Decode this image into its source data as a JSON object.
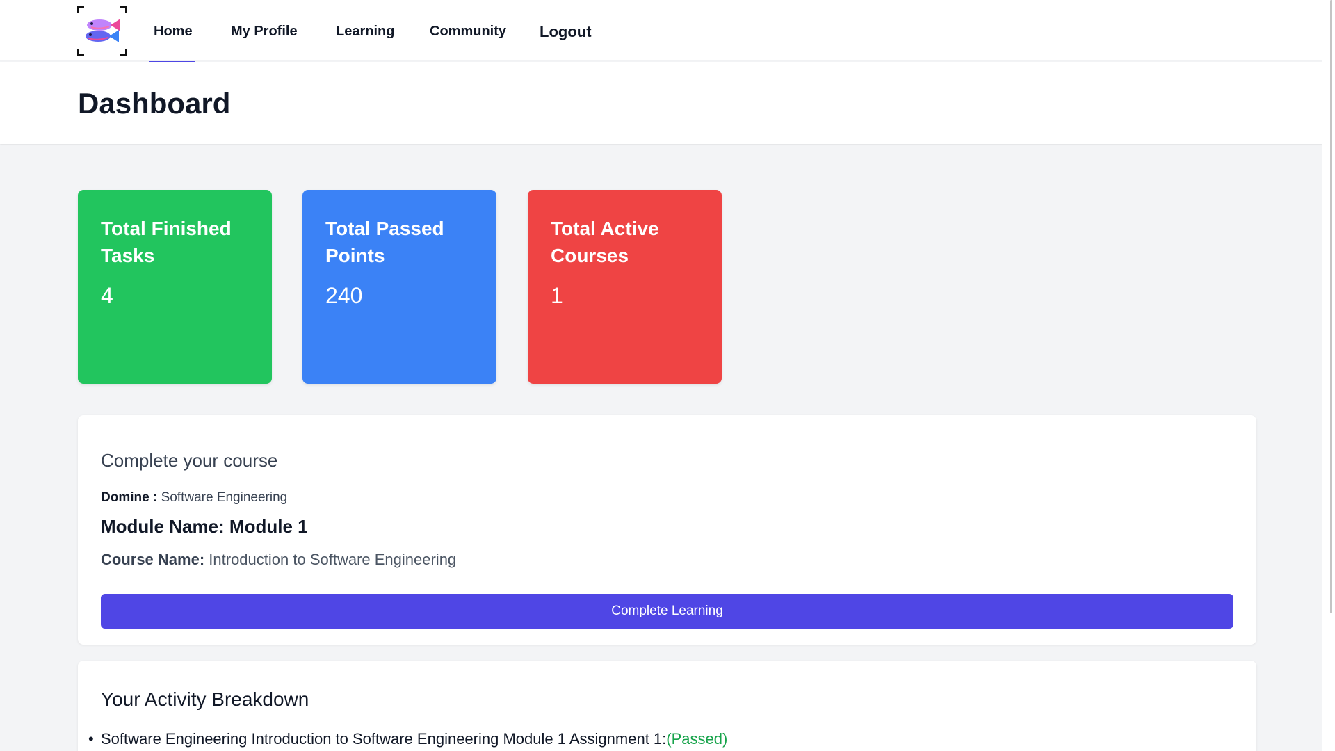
{
  "colors": {
    "accent": "#4f46e5",
    "green_card": "#22c55e",
    "blue_card": "#3b82f6",
    "red_card": "#ef4444",
    "passed": "#16a34a"
  },
  "nav": {
    "logo_icon": "fish-logo-icon",
    "links": [
      {
        "label": "Home",
        "active": true
      },
      {
        "label": "My Profile"
      },
      {
        "label": "Learning"
      },
      {
        "label": "Community"
      },
      {
        "label": "Logout"
      }
    ]
  },
  "header": {
    "title": "Dashboard"
  },
  "stats": [
    {
      "title": "Total Finished Tasks",
      "value": "4"
    },
    {
      "title": "Total Passed Points",
      "value": "240"
    },
    {
      "title": "Total Active Courses",
      "value": "1"
    }
  ],
  "course": {
    "heading": "Complete your course",
    "domain_label": "Domine :",
    "domain_value": "Software Engineering",
    "module_label": "Module Name:",
    "module_value": "Module 1",
    "course_name_label": "Course Name:",
    "course_name_value": "Introduction to Software Engineering",
    "button_label": "Complete Learning"
  },
  "activity": {
    "heading": "Your Activity Breakdown",
    "items": [
      {
        "text": "Software Engineering Introduction to Software Engineering Module 1 Assignment 1:",
        "status": "(Passed)"
      }
    ]
  }
}
